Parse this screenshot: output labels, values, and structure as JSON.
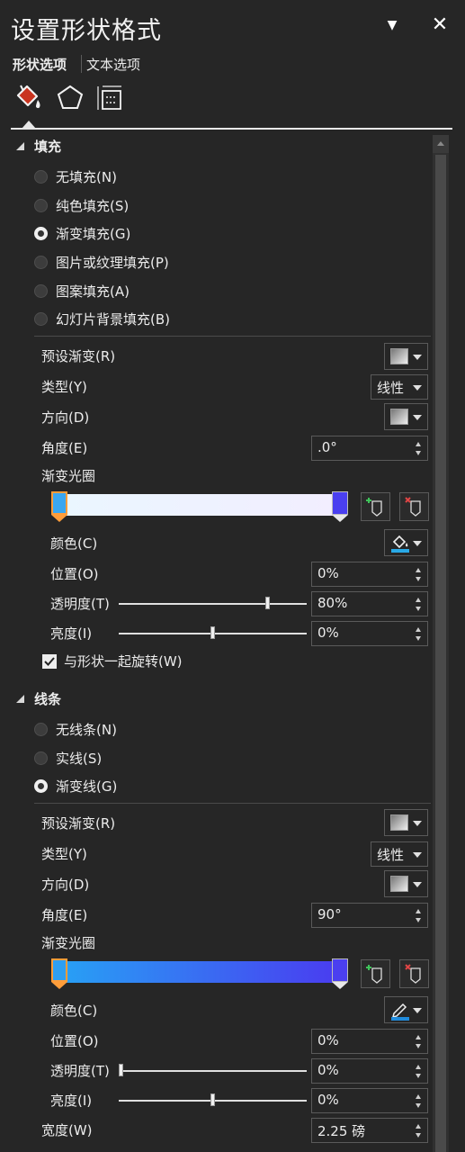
{
  "pane": {
    "title": "设置形状格式",
    "pin_glyph": "▼",
    "close_glyph": "✕"
  },
  "tabs": [
    {
      "label": "形状选项",
      "active": true
    },
    {
      "label": "文本选项",
      "active": false
    }
  ],
  "icon_tabs": [
    "fill-line-icon",
    "effects-pentagon-icon",
    "size-properties-icon"
  ],
  "fill": {
    "header": "填充",
    "options": [
      "无填充(N)",
      "纯色填充(S)",
      "渐变填充(G)",
      "图片或纹理填充(P)",
      "图案填充(A)",
      "幻灯片背景填充(B)"
    ],
    "selected_index": 2,
    "preset_label": "预设渐变(R)",
    "type_label": "类型(Y)",
    "type_value": "线性",
    "direction_label": "方向(D)",
    "angle_label": "角度(E)",
    "angle_value": ".0°",
    "stops_label": "渐变光圈",
    "gradient_colors": [
      "#eaf6ff",
      "#f2eeff"
    ],
    "stop_colors": [
      "#3aa7f0",
      "#4a3ff0"
    ],
    "color_label": "颜色(C)",
    "color_accent": "#29a9e6",
    "position_label": "位置(O)",
    "position_value": "0%",
    "transparency_label": "透明度(T)",
    "transparency_value": "80%",
    "transparency_level": 0.8,
    "brightness_label": "亮度(I)",
    "brightness_value": "0%",
    "brightness_level": 0.5,
    "rotate_label": "与形状一起旋转(W)",
    "rotate_checked": true
  },
  "line": {
    "header": "线条",
    "options": [
      "无线条(N)",
      "实线(S)",
      "渐变线(G)"
    ],
    "selected_index": 2,
    "preset_label": "预设渐变(R)",
    "type_label": "类型(Y)",
    "type_value": "线性",
    "direction_label": "方向(D)",
    "angle_label": "角度(E)",
    "angle_value": "90°",
    "stops_label": "渐变光圈",
    "gradient_colors": [
      "#27a2f5",
      "#4a3bf0"
    ],
    "stop_colors": [
      "#2e9ff2",
      "#4b3ff0"
    ],
    "color_label": "颜色(C)",
    "color_accent": "#1f8bdc",
    "position_label": "位置(O)",
    "position_value": "0%",
    "transparency_label": "透明度(T)",
    "transparency_value": "0%",
    "transparency_level": 0.0,
    "brightness_label": "亮度(I)",
    "brightness_value": "0%",
    "brightness_level": 0.5,
    "width_label": "宽度(W)",
    "width_value": "2.25 磅"
  }
}
